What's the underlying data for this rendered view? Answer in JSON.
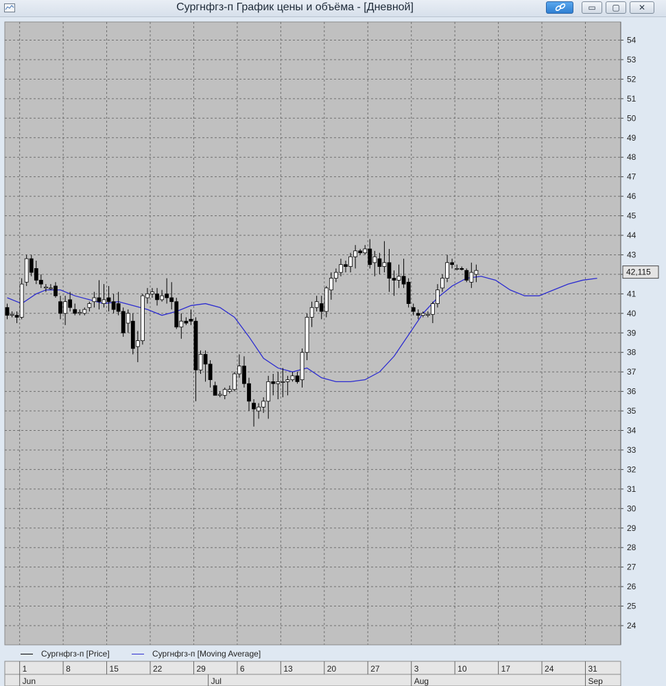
{
  "window": {
    "title": "Сургнфгз-п График цены и объёма - [Дневной]",
    "buttons": {
      "minimize": "▭",
      "maximize": "▢",
      "close": "✕"
    }
  },
  "colors": {
    "plot_bg": "#c0c0c0",
    "grid": "#6e6e6e",
    "candle": "#000000",
    "moving_average": "#2b2bd0",
    "axis_text": "#222222"
  },
  "legend": [
    {
      "label": "Сургнфгз-п [Price]",
      "color": "#000000"
    },
    {
      "label": "Сургнфгз-п [Moving Average]",
      "color": "#2b2bd0"
    }
  ],
  "chart_data": {
    "type": "candlestick",
    "last_value_label": "42,115",
    "ylim": [
      23,
      55
    ],
    "yticks": [
      24,
      25,
      26,
      27,
      28,
      29,
      30,
      31,
      32,
      33,
      34,
      35,
      36,
      37,
      38,
      39,
      40,
      41,
      42,
      43,
      44,
      45,
      46,
      47,
      48,
      49,
      50,
      51,
      52,
      53,
      54
    ],
    "x_day_labels": [
      {
        "label": "1",
        "index": 4
      },
      {
        "label": "8",
        "index": 13
      },
      {
        "label": "15",
        "index": 22
      },
      {
        "label": "22",
        "index": 31
      },
      {
        "label": "29",
        "index": 40
      },
      {
        "label": "6",
        "index": 49
      },
      {
        "label": "13",
        "index": 58
      },
      {
        "label": "20",
        "index": 67
      },
      {
        "label": "27",
        "index": 76
      },
      {
        "label": "3",
        "index": 85
      },
      {
        "label": "10",
        "index": 94
      },
      {
        "label": "17",
        "index": 103
      },
      {
        "label": "24",
        "index": 112
      },
      {
        "label": "31",
        "index": 121
      }
    ],
    "x_month_labels": [
      {
        "label": "Jun",
        "index": 4
      },
      {
        "label": "Jul",
        "index": 43
      },
      {
        "label": "Aug",
        "index": 85
      },
      {
        "label": "Sep",
        "index": 121
      }
    ],
    "candles": [
      [
        1,
        40.3,
        40.5,
        39.7,
        39.9
      ],
      [
        2,
        39.9,
        40.1,
        39.8,
        39.95
      ],
      [
        3,
        39.9,
        40.1,
        39.5,
        39.8
      ],
      [
        4,
        39.8,
        41.8,
        39.7,
        41.5
      ],
      [
        5,
        41.6,
        43.0,
        41.4,
        42.8
      ],
      [
        6,
        42.8,
        43.0,
        41.9,
        42.1
      ],
      [
        7,
        42.3,
        42.7,
        41.5,
        41.7
      ],
      [
        8,
        41.7,
        42.0,
        41.3,
        41.5
      ],
      [
        9,
        41.3,
        41.5,
        41.1,
        41.35
      ],
      [
        10,
        41.3,
        41.5,
        41.2,
        41.3
      ],
      [
        11,
        41.4,
        41.6,
        40.8,
        40.9
      ],
      [
        12,
        40.6,
        40.9,
        39.7,
        40.0
      ],
      [
        13,
        40.0,
        40.9,
        39.4,
        40.6
      ],
      [
        14,
        40.7,
        41.1,
        40.1,
        40.3
      ],
      [
        15,
        40.2,
        40.5,
        39.9,
        40.0
      ],
      [
        16,
        40.0,
        40.2,
        39.9,
        40.05
      ],
      [
        17,
        40.0,
        40.3,
        39.9,
        40.2
      ],
      [
        18,
        40.3,
        40.6,
        40.1,
        40.5
      ],
      [
        19,
        40.6,
        41.1,
        40.3,
        40.8
      ],
      [
        20,
        40.8,
        41.7,
        40.2,
        40.6
      ],
      [
        21,
        40.5,
        41.5,
        40.3,
        40.7
      ],
      [
        22,
        40.8,
        41.4,
        40.1,
        40.6
      ],
      [
        23,
        40.6,
        41.0,
        40.0,
        40.2
      ],
      [
        24,
        40.5,
        41.1,
        39.9,
        40.1
      ],
      [
        25,
        40.1,
        40.3,
        38.8,
        39.0
      ],
      [
        26,
        39.5,
        40.2,
        39.0,
        40.0
      ],
      [
        27,
        39.6,
        40.0,
        37.9,
        38.2
      ],
      [
        28,
        38.3,
        39.1,
        37.5,
        38.6
      ],
      [
        29,
        38.6,
        41.0,
        38.4,
        40.9
      ],
      [
        30,
        40.8,
        41.3,
        40.5,
        41.0
      ],
      [
        31,
        41.0,
        41.3,
        40.8,
        41.1
      ],
      [
        32,
        41.0,
        41.3,
        40.4,
        40.7
      ],
      [
        33,
        40.7,
        41.2,
        40.6,
        40.9
      ],
      [
        34,
        41.0,
        41.8,
        40.5,
        40.8
      ],
      [
        35,
        40.8,
        41.6,
        40.2,
        40.6
      ],
      [
        36,
        40.6,
        40.8,
        39.2,
        39.3
      ],
      [
        37,
        39.3,
        40.0,
        38.7,
        39.6
      ],
      [
        38,
        39.6,
        39.8,
        39.4,
        39.5
      ],
      [
        39,
        39.7,
        40.2,
        39.4,
        39.6
      ],
      [
        40,
        39.6,
        39.8,
        35.5,
        37.1
      ],
      [
        41,
        37.1,
        38.1,
        36.9,
        37.9
      ],
      [
        42,
        37.9,
        38.1,
        36.5,
        37.4
      ],
      [
        43,
        37.4,
        37.6,
        36.2,
        36.6
      ],
      [
        44,
        36.3,
        36.5,
        35.8,
        35.8
      ],
      [
        45,
        35.8,
        36.0,
        35.7,
        35.85
      ],
      [
        46,
        35.8,
        36.2,
        35.6,
        36.1
      ],
      [
        47,
        36.0,
        36.3,
        35.9,
        36.1
      ],
      [
        48,
        36.1,
        37.0,
        36.0,
        36.9
      ],
      [
        49,
        36.9,
        37.9,
        36.7,
        37.3
      ],
      [
        50,
        37.3,
        37.8,
        36.2,
        36.4
      ],
      [
        51,
        36.4,
        36.7,
        35.0,
        35.5
      ],
      [
        52,
        35.4,
        35.6,
        34.2,
        35.1
      ],
      [
        53,
        35.0,
        35.4,
        34.6,
        35.2
      ],
      [
        54,
        35.2,
        35.7,
        34.9,
        35.5
      ],
      [
        55,
        35.5,
        36.8,
        34.6,
        36.5
      ],
      [
        56,
        36.5,
        36.9,
        35.8,
        36.4
      ],
      [
        57,
        36.4,
        37.0,
        35.6,
        36.5
      ],
      [
        58,
        36.5,
        37.2,
        35.7,
        36.5
      ],
      [
        59,
        36.5,
        36.8,
        35.8,
        36.6
      ],
      [
        60,
        36.6,
        37.0,
        36.5,
        36.8
      ],
      [
        61,
        36.8,
        37.0,
        36.4,
        36.5
      ],
      [
        62,
        36.6,
        38.2,
        36.2,
        38.0
      ],
      [
        63,
        38.0,
        40.0,
        37.6,
        39.8
      ],
      [
        64,
        39.8,
        40.6,
        39.3,
        40.3
      ],
      [
        65,
        40.3,
        40.9,
        40.1,
        40.6
      ],
      [
        66,
        40.5,
        40.9,
        39.7,
        40.1
      ],
      [
        67,
        40.1,
        41.4,
        39.8,
        41.3
      ],
      [
        68,
        41.2,
        42.1,
        40.7,
        41.8
      ],
      [
        69,
        41.8,
        42.3,
        41.6,
        42.1
      ],
      [
        70,
        42.1,
        42.8,
        41.9,
        42.5
      ],
      [
        71,
        42.5,
        42.7,
        42.1,
        42.4
      ],
      [
        72,
        42.4,
        43.1,
        42.1,
        42.9
      ],
      [
        73,
        42.9,
        43.5,
        42.3,
        43.2
      ],
      [
        74,
        43.2,
        43.3,
        43.0,
        43.1
      ],
      [
        75,
        43.1,
        43.5,
        43.0,
        43.3
      ],
      [
        76,
        43.3,
        43.8,
        42.3,
        42.5
      ],
      [
        77,
        42.6,
        43.2,
        41.9,
        42.9
      ],
      [
        78,
        42.8,
        43.1,
        42.0,
        42.4
      ],
      [
        79,
        42.4,
        43.7,
        42.1,
        42.6
      ],
      [
        80,
        42.6,
        43.3,
        41.1,
        41.8
      ],
      [
        81,
        41.8,
        42.2,
        40.9,
        41.7
      ],
      [
        82,
        41.7,
        42.5,
        41.3,
        41.9
      ],
      [
        83,
        41.9,
        42.8,
        41.3,
        41.5
      ],
      [
        84,
        41.6,
        41.8,
        40.3,
        40.5
      ],
      [
        85,
        40.3,
        40.5,
        39.9,
        40.1
      ],
      [
        86,
        40.0,
        40.2,
        39.7,
        39.9
      ],
      [
        87,
        39.9,
        40.1,
        39.8,
        40.0
      ],
      [
        88,
        39.9,
        40.1,
        39.8,
        39.95
      ],
      [
        89,
        39.95,
        40.6,
        39.5,
        40.5
      ],
      [
        90,
        40.5,
        41.5,
        40.3,
        41.2
      ],
      [
        91,
        41.3,
        42.0,
        41.1,
        41.8
      ],
      [
        92,
        41.8,
        43.0,
        41.6,
        42.6
      ],
      [
        93,
        42.6,
        42.8,
        42.3,
        42.5
      ],
      [
        94,
        42.3,
        42.5,
        42.2,
        42.3
      ],
      [
        95,
        42.3,
        42.4,
        42.2,
        42.25
      ],
      [
        96,
        42.2,
        42.3,
        41.6,
        41.7
      ],
      [
        97,
        41.6,
        42.6,
        41.3,
        42.1
      ],
      [
        98,
        42.0,
        42.5,
        41.6,
        42.2
      ]
    ],
    "moving_average": [
      [
        1,
        40.8
      ],
      [
        4,
        40.5
      ],
      [
        7,
        41.0
      ],
      [
        9,
        41.2
      ],
      [
        12,
        41.2
      ],
      [
        15,
        40.9
      ],
      [
        18,
        40.7
      ],
      [
        21,
        40.5
      ],
      [
        24,
        40.6
      ],
      [
        27,
        40.4
      ],
      [
        30,
        40.2
      ],
      [
        33,
        39.9
      ],
      [
        36,
        40.1
      ],
      [
        39,
        40.4
      ],
      [
        42,
        40.5
      ],
      [
        45,
        40.3
      ],
      [
        48,
        39.8
      ],
      [
        51,
        38.8
      ],
      [
        54,
        37.7
      ],
      [
        57,
        37.2
      ],
      [
        60,
        37.0
      ],
      [
        63,
        37.2
      ],
      [
        66,
        36.7
      ],
      [
        69,
        36.5
      ],
      [
        72,
        36.5
      ],
      [
        75,
        36.6
      ],
      [
        78,
        37.0
      ],
      [
        81,
        37.8
      ],
      [
        84,
        38.9
      ],
      [
        87,
        40.0
      ],
      [
        90,
        40.8
      ],
      [
        93,
        41.4
      ],
      [
        96,
        41.8
      ],
      [
        99,
        41.9
      ],
      [
        102,
        41.7
      ],
      [
        105,
        41.2
      ],
      [
        108,
        40.9
      ],
      [
        111,
        40.9
      ],
      [
        114,
        41.2
      ],
      [
        117,
        41.5
      ],
      [
        120,
        41.7
      ],
      [
        123,
        41.8
      ]
    ]
  }
}
